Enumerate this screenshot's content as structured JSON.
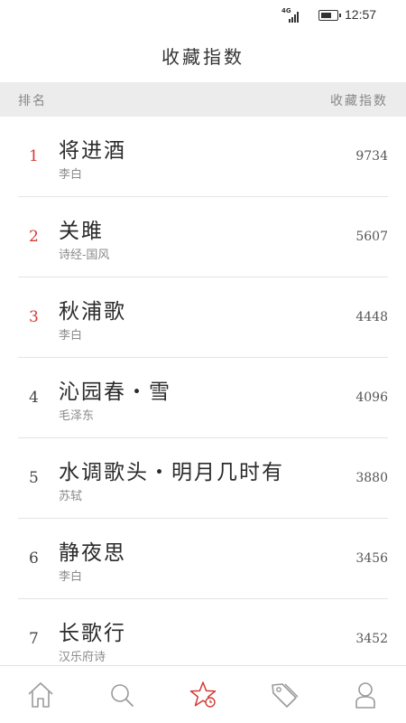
{
  "status": {
    "network": "4G",
    "time": "12:57"
  },
  "header": {
    "title": "收藏指数"
  },
  "table": {
    "rank_header": "排名",
    "favorites_header": "收藏指数"
  },
  "rows": [
    {
      "rank": "1",
      "title": "将进酒",
      "author": "李白",
      "count": "9734",
      "highlight": true
    },
    {
      "rank": "2",
      "title": "关雎",
      "author": "诗经-国风",
      "count": "5607",
      "highlight": true
    },
    {
      "rank": "3",
      "title": "秋浦歌",
      "author": "李白",
      "count": "4448",
      "highlight": true
    },
    {
      "rank": "4",
      "title": "沁园春・雪",
      "author": "毛泽东",
      "count": "4096",
      "highlight": false
    },
    {
      "rank": "5",
      "title": "水调歌头・明月几时有",
      "author": "苏轼",
      "count": "3880",
      "highlight": false
    },
    {
      "rank": "6",
      "title": "静夜思",
      "author": "李白",
      "count": "3456",
      "highlight": false
    },
    {
      "rank": "7",
      "title": "长歌行",
      "author": "汉乐府诗",
      "count": "3452",
      "highlight": false
    }
  ],
  "tabs": [
    {
      "icon": "home-icon",
      "active": false
    },
    {
      "icon": "search-icon",
      "active": false
    },
    {
      "icon": "star-icon",
      "active": true
    },
    {
      "icon": "tag-icon",
      "active": false
    },
    {
      "icon": "user-icon",
      "active": false
    }
  ],
  "colors": {
    "accent": "#d33a36",
    "header_bg": "#ececec",
    "icon_inactive": "#9a9a9a"
  }
}
